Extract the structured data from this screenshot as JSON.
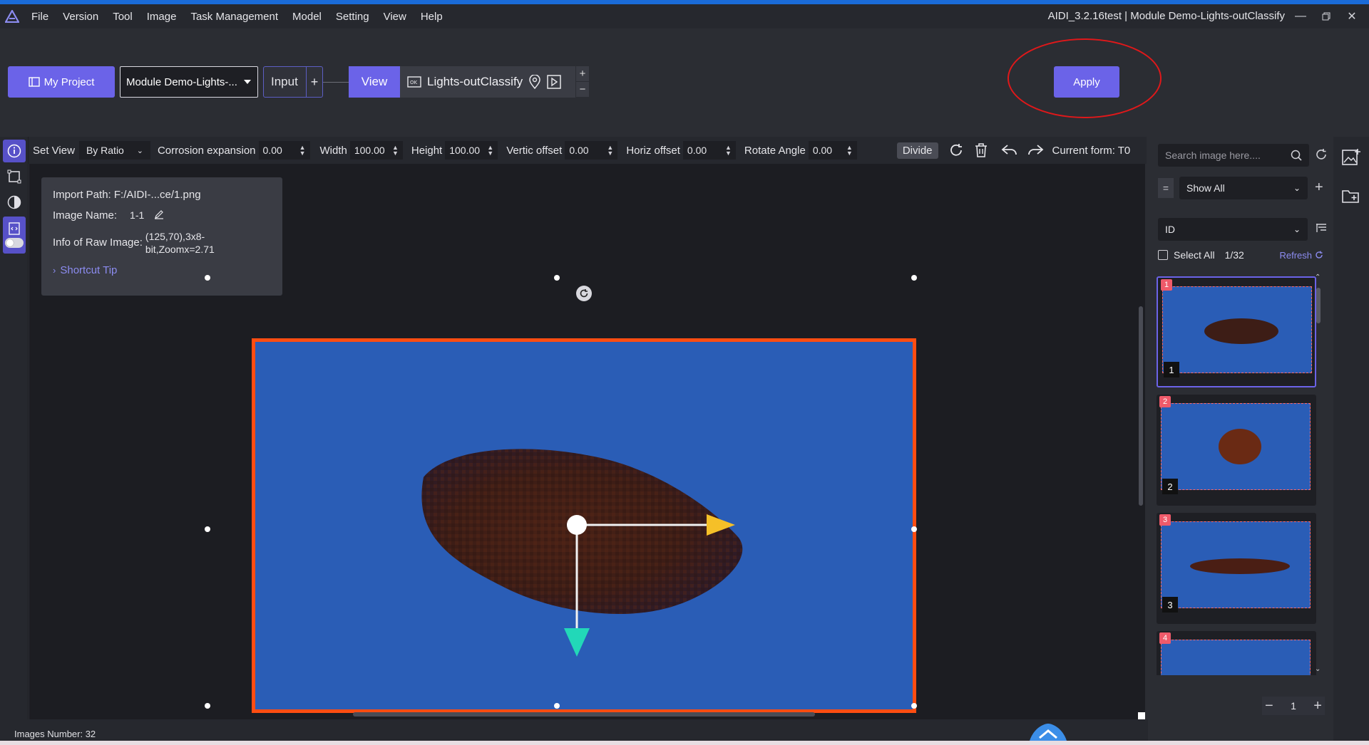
{
  "menubar": {
    "items": [
      "File",
      "Version",
      "Tool",
      "Image",
      "Task Management",
      "Model",
      "Setting",
      "View",
      "Help"
    ],
    "window_title": "AIDI_3.2.16test | Module Demo-Lights-outClassify"
  },
  "project_bar": {
    "my_project": "My Project",
    "module_select": "Module Demo-Lights-...",
    "input_label": "Input",
    "input_plus": "+",
    "view_label": "View",
    "node_label": "Lights-outClassify",
    "node_plus": "+",
    "node_minus": "−",
    "apply_label": "Apply"
  },
  "params": {
    "set_view": "Set View",
    "ratio_select": "By Ratio",
    "corrosion_label": "Corrosion expansion",
    "corrosion_value": "0.00",
    "width_label": "Width",
    "width_value": "100.00",
    "height_label": "Height",
    "height_value": "100.00",
    "vert_label": "Vertic offset",
    "vert_value": "0.00",
    "horiz_label": "Horiz offset",
    "horiz_value": "0.00",
    "rotate_label": "Rotate Angle",
    "rotate_value": "0.00",
    "divide_label": "Divide",
    "current_form": "Current form: T0"
  },
  "info": {
    "import_path": "Import Path: F:/AIDI-...ce/1.png",
    "image_name_label": "Image Name:",
    "image_name_value": "1-1",
    "raw_info_label": "Info of Raw Image:",
    "raw_info_line1": "(125,70),3x8-",
    "raw_info_line2": "bit,Zoomx=2.71",
    "shortcut_tip": "Shortcut Tip"
  },
  "status": {
    "images_number": "Images Number: 32"
  },
  "image_list": {
    "search_placeholder": "Search image here....",
    "eq_symbol": "=",
    "filter_value": "Show All",
    "sort_value": "ID",
    "select_all": "Select All",
    "count": "1/32",
    "refresh": "Refresh",
    "thumbs": [
      {
        "top_badge": "1",
        "bottom_badge": "1"
      },
      {
        "top_badge": "2",
        "bottom_badge": "2"
      },
      {
        "top_badge": "3",
        "bottom_badge": "3"
      },
      {
        "top_badge": "4",
        "bottom_badge": ""
      }
    ],
    "page": "1"
  },
  "colors": {
    "accent": "#6b63e8",
    "roi_border": "#ff4d12",
    "image_bg": "#2a5db6",
    "highlight_ellipse": "#e0181a",
    "arrow_x": "#f5c028",
    "arrow_y": "#22d8b8"
  }
}
